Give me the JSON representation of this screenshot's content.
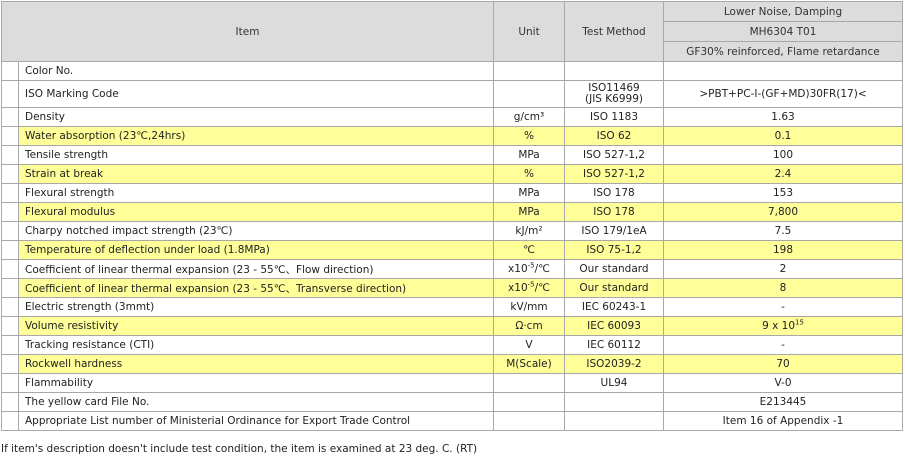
{
  "header": {
    "item": "Item",
    "unit": "Unit",
    "test_method": "Test Method",
    "grade_line1": "Lower Noise, Damping",
    "grade_line2": "MH6304 T01",
    "grade_line3": "GF30% reinforced, Flame retardance"
  },
  "rows": [
    {
      "item": "Color No.",
      "unit": "",
      "method": "",
      "value": "",
      "highlight": false
    },
    {
      "item": "ISO Marking Code",
      "unit": "",
      "method": "ISO11469",
      "method2": "(JIS K6999)",
      "value": ">PBT+PC-I-(GF+MD)30FR(17)<",
      "highlight": false
    },
    {
      "item": "Density",
      "unit": "g/cm³",
      "method": "ISO 1183",
      "value": "1.63",
      "highlight": false
    },
    {
      "item": "Water absorption (23℃,24hrs)",
      "unit": "%",
      "method": "ISO 62",
      "value": "0.1",
      "highlight": true
    },
    {
      "item": "Tensile strength",
      "unit": "MPa",
      "method": "ISO 527-1,2",
      "value": "100",
      "highlight": false
    },
    {
      "item": "Strain at break",
      "unit": "%",
      "method": "ISO 527-1,2",
      "value": "2.4",
      "highlight": true
    },
    {
      "item": "Flexural strength",
      "unit": "MPa",
      "method": "ISO 178",
      "value": "153",
      "highlight": false
    },
    {
      "item": "Flexural modulus",
      "unit": "MPa",
      "method": "ISO 178",
      "value": "7,800",
      "highlight": true
    },
    {
      "item": "Charpy notched impact strength (23℃)",
      "unit": "kJ/m²",
      "method": "ISO 179/1eA",
      "value": "7.5",
      "highlight": false
    },
    {
      "item": "Temperature of deflection under load (1.8MPa)",
      "unit": "℃",
      "method": "ISO 75-1,2",
      "value": "198",
      "highlight": true
    },
    {
      "item": "Coefficient of linear thermal expansion (23 - 55℃、Flow direction)",
      "unit": "x10",
      "unit_sup": "-5",
      "unit_tail": "/℃",
      "method": "Our standard",
      "value": "2",
      "highlight": false
    },
    {
      "item": "Coefficient of linear thermal expansion (23 - 55℃、Transverse direction)",
      "unit": "x10",
      "unit_sup": "-5",
      "unit_tail": "/℃",
      "method": "Our standard",
      "value": "8",
      "highlight": true
    },
    {
      "item": "Electric strength (3mmt)",
      "unit": "kV/mm",
      "method": "IEC 60243-1",
      "value": "-",
      "highlight": false
    },
    {
      "item": "Volume resistivity",
      "unit": "Ω·cm",
      "method": "IEC 60093",
      "value": "9 x 10",
      "value_sup": "15",
      "highlight": true
    },
    {
      "item": "Tracking resistance (CTI)",
      "unit": "V",
      "method": "IEC 60112",
      "value": "-",
      "highlight": false
    },
    {
      "item": "Rockwell hardness",
      "unit": "M(Scale)",
      "method": "ISO2039-2",
      "value": "70",
      "highlight": true
    },
    {
      "item": "Flammability",
      "unit": "",
      "method": "UL94",
      "value": "V-0",
      "highlight": false
    },
    {
      "item": "The yellow card File No.",
      "unit": "",
      "method": "",
      "value": "E213445",
      "highlight": false
    },
    {
      "item": "Appropriate List number of Ministerial Ordinance for Export Trade Control",
      "unit": "",
      "method": "",
      "value": "Item 16 of Appendix -1",
      "highlight": false
    }
  ],
  "footnote": "If item's description doesn't include test condition, the item is examined at 23 deg. C. (RT)"
}
